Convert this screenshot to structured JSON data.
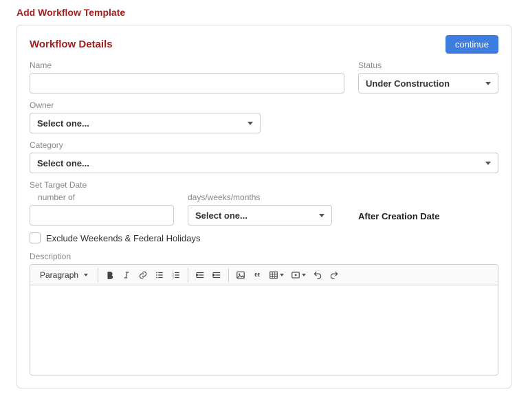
{
  "page_title": "Add Workflow Template",
  "card": {
    "title": "Workflow Details",
    "continue_label": "continue"
  },
  "labels": {
    "name": "Name",
    "status": "Status",
    "owner": "Owner",
    "category": "Category",
    "set_target": "Set Target Date",
    "number_of": "number of",
    "units": "days/weeks/months",
    "after_creation": "After Creation Date",
    "exclude": "Exclude Weekends & Federal Holidays",
    "description": "Description"
  },
  "values": {
    "name": "",
    "status": "Under Construction",
    "owner": "Select one...",
    "category": "Select one...",
    "number_of": "",
    "units": "Select one...",
    "exclude_checked": false
  },
  "editor": {
    "block_format": "Paragraph"
  }
}
